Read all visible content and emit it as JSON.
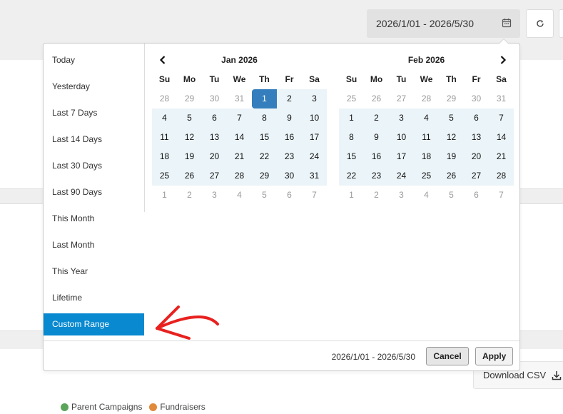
{
  "header": {
    "date_range_value": "2026/1/01 - 2026/5/30"
  },
  "picker": {
    "ranges": [
      {
        "label": "Today"
      },
      {
        "label": "Yesterday"
      },
      {
        "label": "Last 7 Days"
      },
      {
        "label": "Last 14 Days"
      },
      {
        "label": "Last 30 Days"
      },
      {
        "label": "Last 90 Days"
      },
      {
        "label": "This Month"
      },
      {
        "label": "Last Month"
      },
      {
        "label": "This Year"
      },
      {
        "label": "Lifetime"
      },
      {
        "label": "Custom Range",
        "active": true
      }
    ],
    "weekdays": [
      "Su",
      "Mo",
      "Tu",
      "We",
      "Th",
      "Fr",
      "Sa"
    ],
    "calendars": [
      {
        "title": "Jan 2026",
        "days": [
          [
            "28",
            "29",
            "30",
            "31",
            "1",
            "2",
            "3"
          ],
          [
            "4",
            "5",
            "6",
            "7",
            "8",
            "9",
            "10"
          ],
          [
            "11",
            "12",
            "13",
            "14",
            "15",
            "16",
            "17"
          ],
          [
            "18",
            "19",
            "20",
            "21",
            "22",
            "23",
            "24"
          ],
          [
            "25",
            "26",
            "27",
            "28",
            "29",
            "30",
            "31"
          ],
          [
            "1",
            "2",
            "3",
            "4",
            "5",
            "6",
            "7"
          ]
        ],
        "in_month": [
          [
            0,
            0,
            0,
            0,
            1,
            1,
            1
          ],
          [
            1,
            1,
            1,
            1,
            1,
            1,
            1
          ],
          [
            1,
            1,
            1,
            1,
            1,
            1,
            1
          ],
          [
            1,
            1,
            1,
            1,
            1,
            1,
            1
          ],
          [
            1,
            1,
            1,
            1,
            1,
            1,
            1
          ],
          [
            0,
            0,
            0,
            0,
            0,
            0,
            0
          ]
        ],
        "start_day": "1"
      },
      {
        "title": "Feb 2026",
        "days": [
          [
            "25",
            "26",
            "27",
            "28",
            "29",
            "30",
            "31"
          ],
          [
            "1",
            "2",
            "3",
            "4",
            "5",
            "6",
            "7"
          ],
          [
            "8",
            "9",
            "10",
            "11",
            "12",
            "13",
            "14"
          ],
          [
            "15",
            "16",
            "17",
            "18",
            "19",
            "20",
            "21"
          ],
          [
            "22",
            "23",
            "24",
            "25",
            "26",
            "27",
            "28"
          ],
          [
            "1",
            "2",
            "3",
            "4",
            "5",
            "6",
            "7"
          ]
        ],
        "in_month": [
          [
            0,
            0,
            0,
            0,
            0,
            0,
            0
          ],
          [
            1,
            1,
            1,
            1,
            1,
            1,
            1
          ],
          [
            1,
            1,
            1,
            1,
            1,
            1,
            1
          ],
          [
            1,
            1,
            1,
            1,
            1,
            1,
            1
          ],
          [
            1,
            1,
            1,
            1,
            1,
            1,
            1
          ],
          [
            0,
            0,
            0,
            0,
            0,
            0,
            0
          ]
        ],
        "start_day": ""
      }
    ],
    "selected_text": "2026/1/01 - 2026/5/30",
    "cancel_label": "Cancel",
    "apply_label": "Apply"
  },
  "download_label": "Download CSV",
  "legend": [
    {
      "label": "Parent Campaigns",
      "color": "#5aa55a"
    },
    {
      "label": "Fundraisers",
      "color": "#e08a3a"
    }
  ],
  "colors": {
    "accent": "#0889d0",
    "selected_day": "#357ebd",
    "range_fill": "#ebf4f8",
    "annotation": "#e8211f"
  }
}
